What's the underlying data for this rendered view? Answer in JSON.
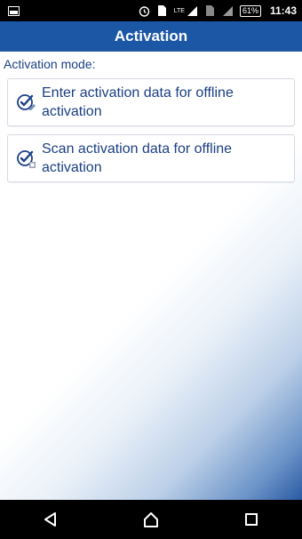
{
  "status_bar": {
    "lte_label": "LTE",
    "sim_label": "1",
    "battery": "61%",
    "time": "11:43"
  },
  "header": {
    "title": "Activation"
  },
  "main": {
    "mode_label": "Activation mode:",
    "options": [
      {
        "label": "Enter activation data for offline activation",
        "icon": "checkmark-edit-icon"
      },
      {
        "label": "Scan activation data for offline activation",
        "icon": "checkmark-scan-icon"
      }
    ]
  },
  "nav": {
    "back_icon": "back-triangle-icon",
    "home_icon": "home-icon",
    "recents_icon": "recents-square-icon"
  },
  "colors": {
    "title_bar": "#1c57a6",
    "text": "#1c3f85"
  }
}
